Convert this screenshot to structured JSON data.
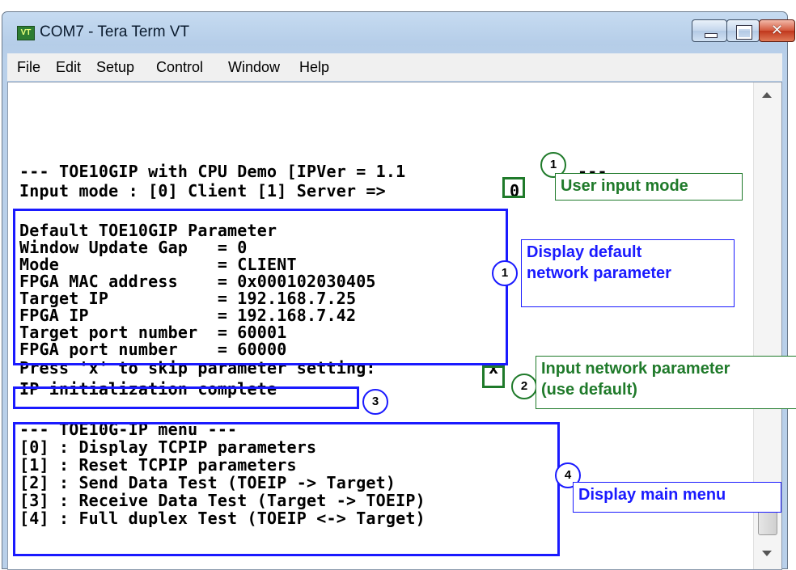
{
  "window": {
    "title": "COM7 - Tera Term VT",
    "icon_text": "VT"
  },
  "menu": [
    {
      "label": "File"
    },
    {
      "label": "Edit"
    },
    {
      "label": "Setup"
    },
    {
      "label": "Control"
    },
    {
      "label": "Window"
    },
    {
      "label": "Help"
    }
  ],
  "terminal": {
    "header": "--- TOE10GIP with CPU Demo [IPVer = 1.1",
    "header_tail": "---",
    "input_mode": "Input mode : [0] Client [1] Server =>",
    "input_mode_value": "0",
    "params": [
      "Default TOE10GIP Parameter",
      "Window Update Gap   = 0",
      "Mode                = CLIENT",
      "FPGA MAC address    = 0x000102030405",
      "Target IP           = 192.168.7.25",
      "FPGA IP             = 192.168.7.42",
      "Target port number  = 60001",
      "FPGA port number    = 60000"
    ],
    "skip_prompt": "Press 'x' to skip parameter setting:",
    "skip_value": "x",
    "init_complete": "IP initialization complete",
    "menu_lines": [
      "--- TOE10G-IP menu ---",
      "[0] : Display TCPIP parameters",
      "[1] : Reset TCPIP parameters",
      "[2] : Send Data Test (TOEIP -> Target)",
      "[3] : Receive Data Test (Target -> TOEIP)",
      "[4] : Full duplex Test (TOEIP <-> Target)"
    ]
  },
  "annotations": {
    "user_input_mode": {
      "number": "1",
      "text": "User input mode"
    },
    "display_default": {
      "number": "1",
      "line1": "Display default",
      "line2": "network parameter"
    },
    "input_network": {
      "number": "2",
      "line1": "Input network parameter",
      "line2": "(use default)"
    },
    "init": {
      "number": "3"
    },
    "main_menu": {
      "number": "4",
      "text": "Display main menu"
    }
  },
  "colors": {
    "annotation_blue": "#1a1aff",
    "annotation_green": "#1f7a2a"
  }
}
